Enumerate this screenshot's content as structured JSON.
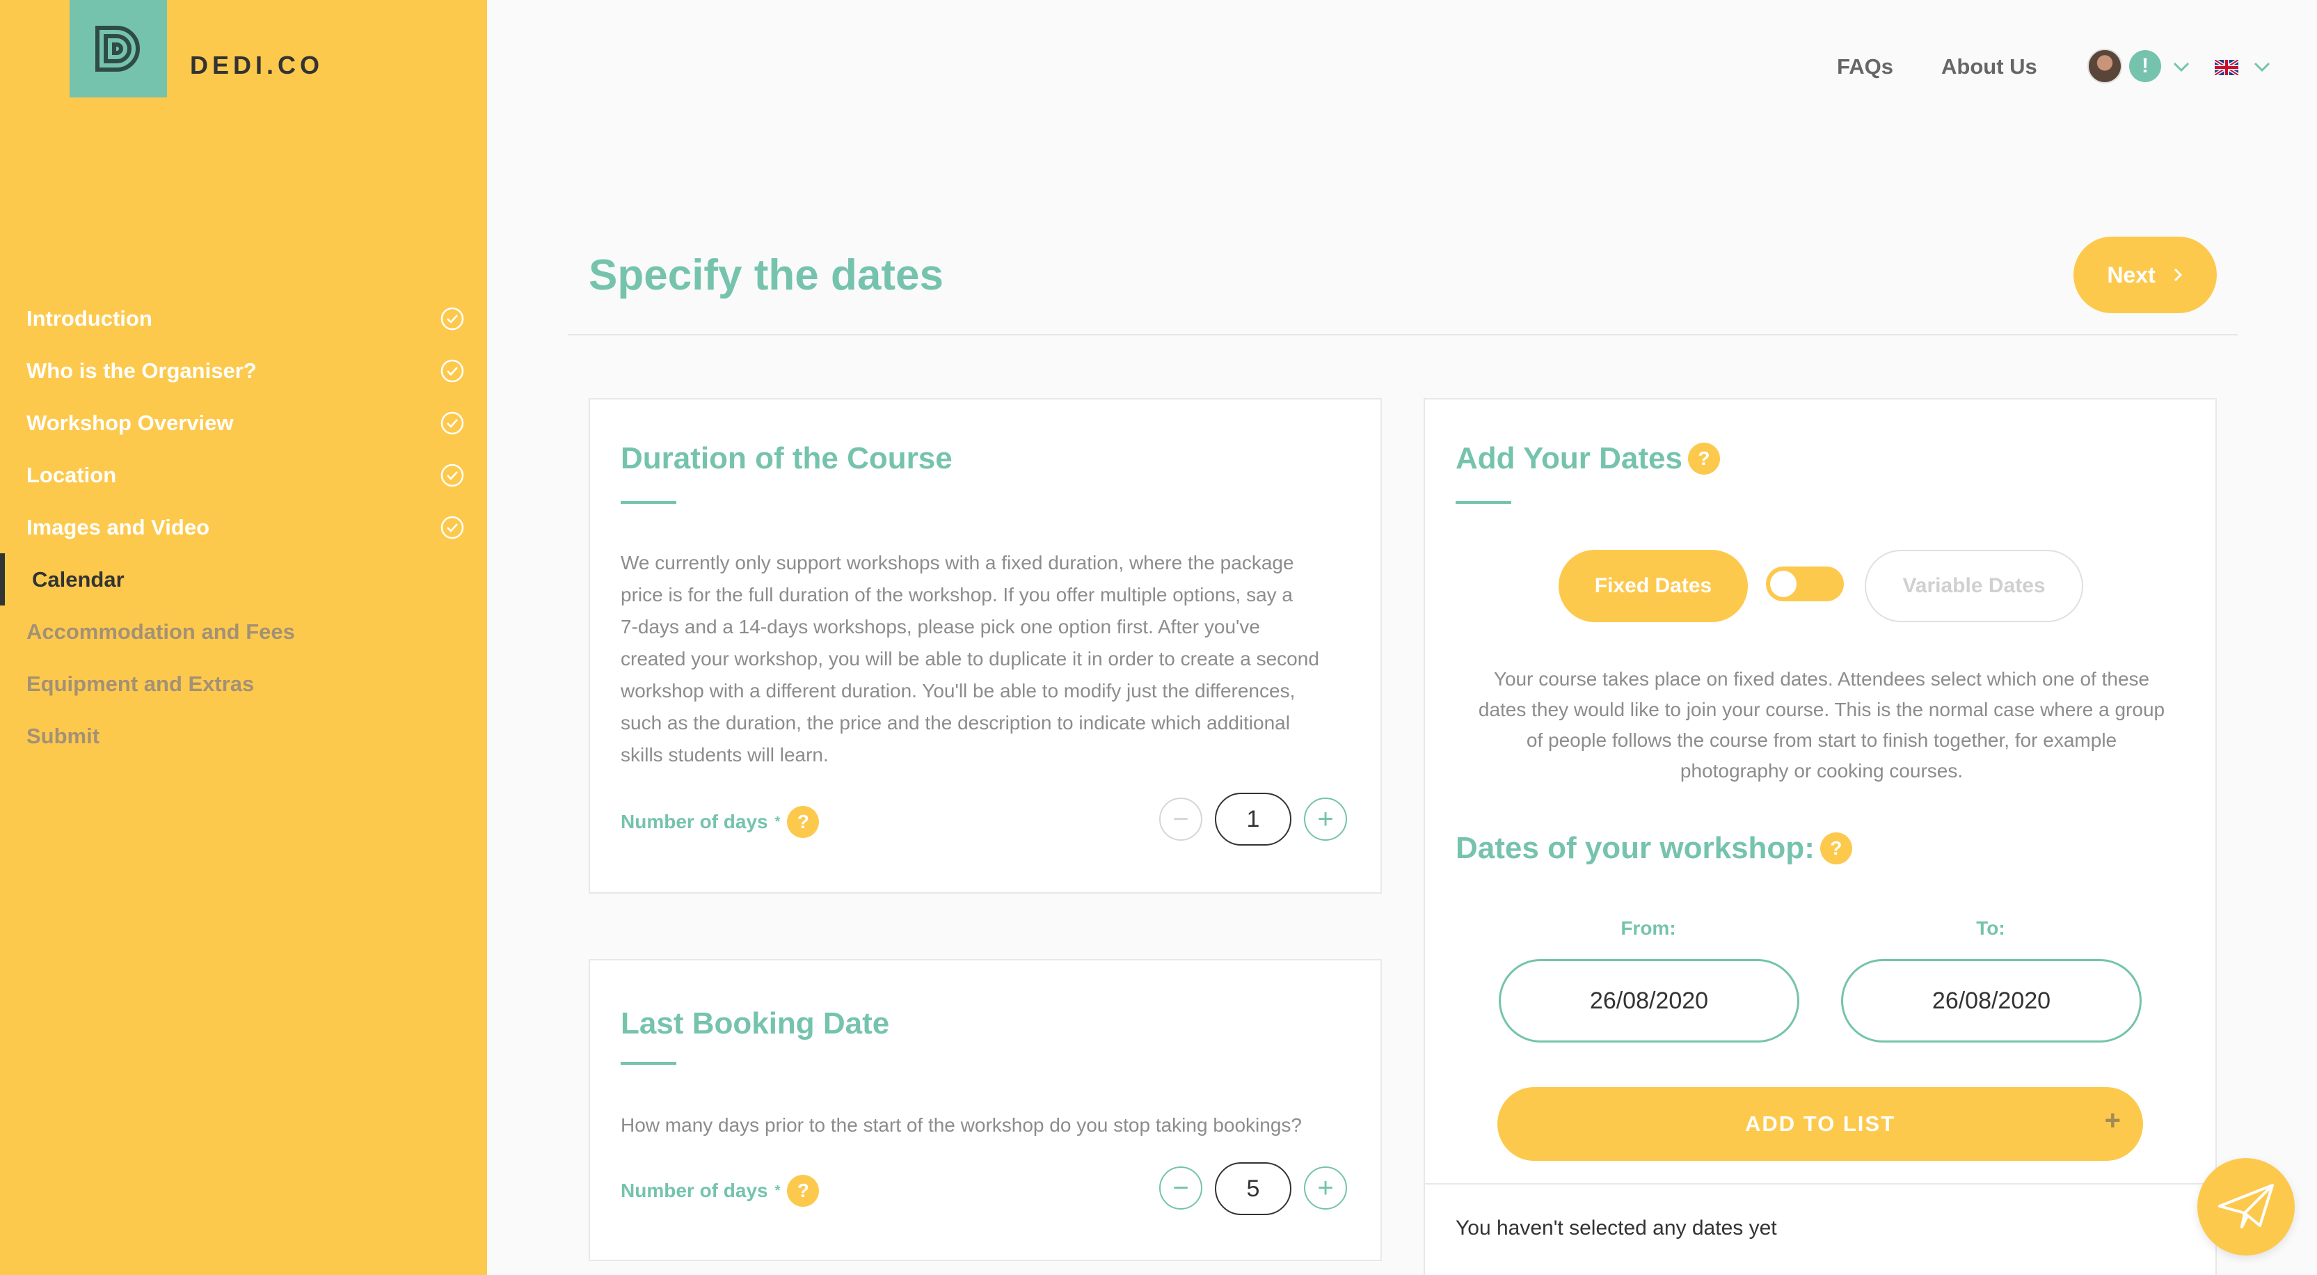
{
  "brand": {
    "name": "DEDI.CO",
    "logo_color": "#75c3ad",
    "accent": "#fdc94d"
  },
  "topnav": {
    "faqs": "FAQs",
    "about": "About Us",
    "alert": "!"
  },
  "sidebar": {
    "items": [
      {
        "label": "Introduction",
        "state": "done"
      },
      {
        "label": "Who is the Organiser?",
        "state": "done"
      },
      {
        "label": "Workshop Overview",
        "state": "done"
      },
      {
        "label": "Location",
        "state": "done"
      },
      {
        "label": "Images and Video",
        "state": "done"
      },
      {
        "label": "Calendar",
        "state": "active"
      },
      {
        "label": "Accommodation and Fees",
        "state": "pending"
      },
      {
        "label": "Equipment and Extras",
        "state": "pending"
      },
      {
        "label": "Submit",
        "state": "pending"
      }
    ]
  },
  "header": {
    "title": "Specify the dates",
    "next_label": "Next"
  },
  "duration": {
    "title": "Duration of the Course",
    "lines": [
      "We currently only support workshops with a fixed duration, where the package",
      "price is for the full duration of the workshop. If you offer multiple options, say a",
      "7-days and a 14-days workshops, please pick one option first. After you've",
      "created your workshop, you will be able to duplicate it in order to create a second",
      "workshop with a different duration. You'll be able to modify just the differences,",
      "such as the duration, the price and the description to indicate which additional",
      "skills students will learn."
    ],
    "field_label": "Number of days",
    "required_mark": "*",
    "help": "?",
    "value": "1",
    "minus": "−",
    "plus": "+"
  },
  "booking": {
    "title": "Last Booking Date",
    "text": "How many days prior to the start of the workshop do you stop taking bookings?",
    "field_label": "Number of days",
    "required_mark": "*",
    "help": "?",
    "value": "5",
    "minus": "−",
    "plus": "+"
  },
  "dates": {
    "title": "Add Your Dates",
    "help": "?",
    "fixed_label": "Fixed Dates",
    "variable_label": "Variable Dates",
    "lines": [
      "Your course takes place on fixed dates. Attendees select which one of these",
      "dates they would like to join your course. This is the normal case where a group",
      "of people follows the course from start to finish together, for example",
      "photography or cooking courses."
    ],
    "workshop_title": "Dates of your workshop:",
    "from_label": "From:",
    "to_label": "To:",
    "from_value": "26/08/2020",
    "to_value": "26/08/2020",
    "add_label": "ADD TO LIST",
    "add_plus": "+",
    "empty_text": "You haven't selected any dates yet"
  }
}
